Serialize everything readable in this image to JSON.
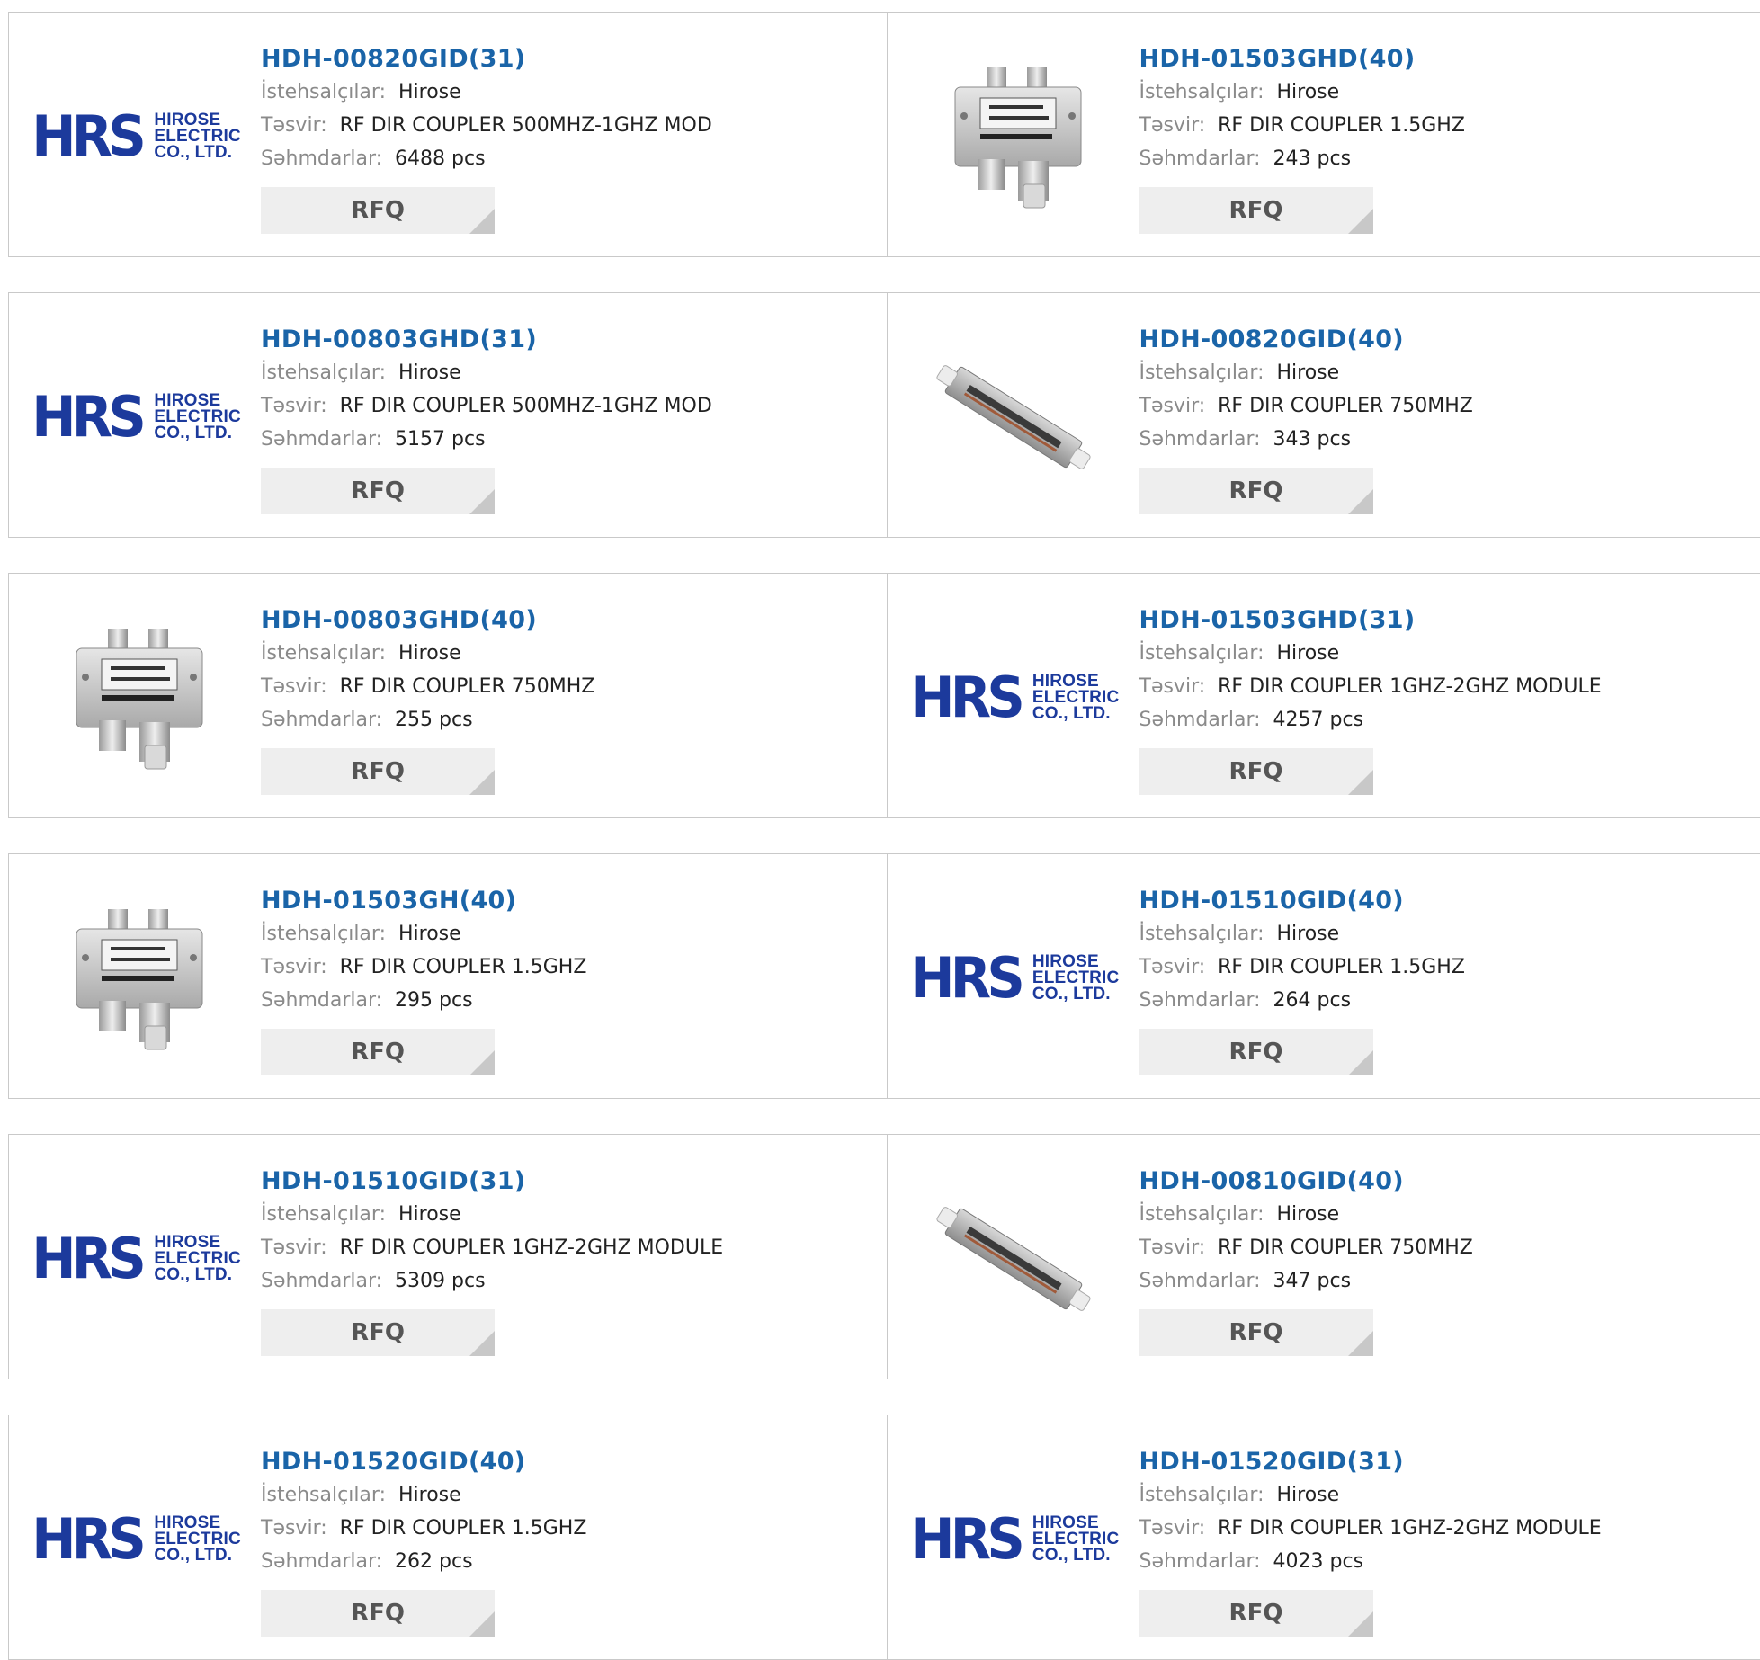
{
  "labels": {
    "manufacturer": "İstehsalçılar:",
    "description": "Təsvir:",
    "stock": "Səhmdarlar:",
    "rfq": "RFQ"
  },
  "logo": {
    "mark": "HRS",
    "line1": "HIROSE",
    "line2": "ELECTRIC",
    "line3": "CO., LTD."
  },
  "products": [
    {
      "part": "HDH-00820GID(31)",
      "manufacturer": "Hirose",
      "description": "RF DIR COUPLER 500MHZ-1GHZ MOD",
      "stock": "6488 pcs",
      "image": "hrs-logo"
    },
    {
      "part": "HDH-01503GHD(40)",
      "manufacturer": "Hirose",
      "description": "RF DIR COUPLER 1.5GHZ",
      "stock": "243 pcs",
      "image": "box-coupler"
    },
    {
      "part": "HDH-00803GHD(31)",
      "manufacturer": "Hirose",
      "description": "RF DIR COUPLER 500MHZ-1GHZ MOD",
      "stock": "5157 pcs",
      "image": "hrs-logo"
    },
    {
      "part": "HDH-00820GID(40)",
      "manufacturer": "Hirose",
      "description": "RF DIR COUPLER 750MHZ",
      "stock": "343 pcs",
      "image": "bar-coupler"
    },
    {
      "part": "HDH-00803GHD(40)",
      "manufacturer": "Hirose",
      "description": "RF DIR COUPLER 750MHZ",
      "stock": "255 pcs",
      "image": "box-coupler"
    },
    {
      "part": "HDH-01503GHD(31)",
      "manufacturer": "Hirose",
      "description": "RF DIR COUPLER 1GHZ-2GHZ MODULE",
      "stock": "4257 pcs",
      "image": "hrs-logo"
    },
    {
      "part": "HDH-01503GH(40)",
      "manufacturer": "Hirose",
      "description": "RF DIR COUPLER 1.5GHZ",
      "stock": "295 pcs",
      "image": "box-coupler"
    },
    {
      "part": "HDH-01510GID(40)",
      "manufacturer": "Hirose",
      "description": "RF DIR COUPLER 1.5GHZ",
      "stock": "264 pcs",
      "image": "hrs-logo"
    },
    {
      "part": "HDH-01510GID(31)",
      "manufacturer": "Hirose",
      "description": "RF DIR COUPLER 1GHZ-2GHZ MODULE",
      "stock": "5309 pcs",
      "image": "hrs-logo"
    },
    {
      "part": "HDH-00810GID(40)",
      "manufacturer": "Hirose",
      "description": "RF DIR COUPLER 750MHZ",
      "stock": "347 pcs",
      "image": "bar-coupler"
    },
    {
      "part": "HDH-01520GID(40)",
      "manufacturer": "Hirose",
      "description": "RF DIR COUPLER 1.5GHZ",
      "stock": "262 pcs",
      "image": "hrs-logo"
    },
    {
      "part": "HDH-01520GID(31)",
      "manufacturer": "Hirose",
      "description": "RF DIR COUPLER 1GHZ-2GHZ MODULE",
      "stock": "4023 pcs",
      "image": "hrs-logo"
    }
  ]
}
